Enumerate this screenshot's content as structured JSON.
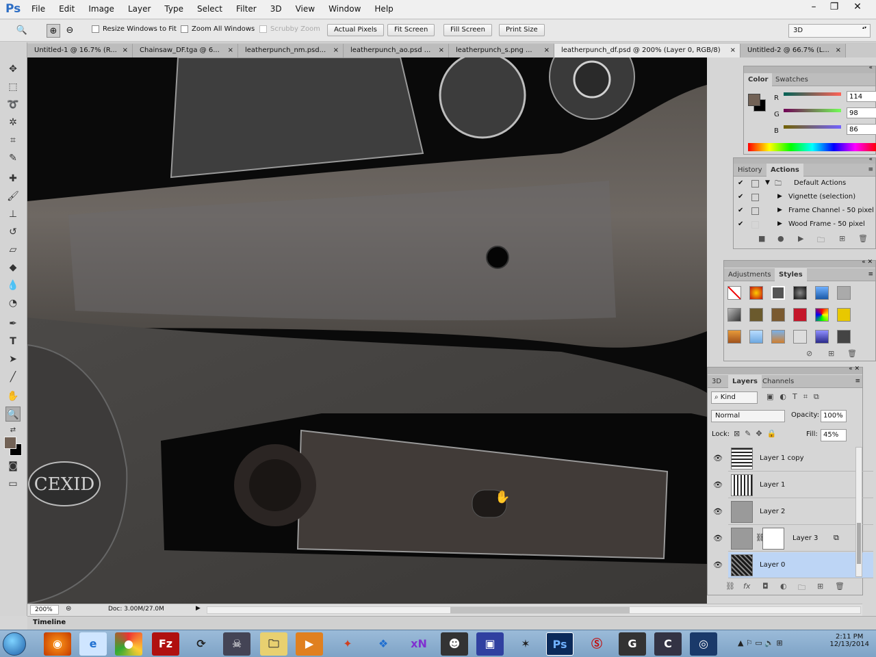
{
  "app": {
    "logo": "Ps",
    "menus": [
      "File",
      "Edit",
      "Image",
      "Layer",
      "Type",
      "Select",
      "Filter",
      "3D",
      "View",
      "Window",
      "Help"
    ]
  },
  "options": {
    "resize_windows": "Resize Windows to Fit",
    "zoom_all": "Zoom All Windows",
    "scrubby": "Scrubby Zoom",
    "actual_pixels": "Actual Pixels",
    "fit_screen": "Fit Screen",
    "fill_screen": "Fill Screen",
    "print_size": "Print Size",
    "workspace": "3D"
  },
  "tabs": [
    {
      "label": "Untitled-1 @ 16.7% (R..."
    },
    {
      "label": "Chainsaw_DF.tga @ 6..."
    },
    {
      "label": "leatherpunch_nm.psd..."
    },
    {
      "label": "leatherpunch_ao.psd ..."
    },
    {
      "label": "leatherpunch_s.png ..."
    },
    {
      "label": "leatherpunch_df.psd @ 200% (Layer 0, RGB/8)"
    },
    {
      "label": "Untitled-2 @ 66.7% (L..."
    }
  ],
  "color_panel": {
    "tabs": [
      "Color",
      "Swatches"
    ],
    "r_label": "R",
    "g_label": "G",
    "b_label": "B",
    "r": "114",
    "g": "98",
    "b": "86",
    "fg": "#726256",
    "bg": "#000000"
  },
  "history_panel": {
    "tabs": [
      "History",
      "Actions"
    ],
    "items": [
      {
        "label": "Default Actions"
      },
      {
        "label": "Vignette (selection)"
      },
      {
        "label": "Frame Channel - 50 pixel"
      },
      {
        "label": "Wood Frame - 50 pixel"
      }
    ]
  },
  "styles_panel": {
    "tabs": [
      "Adjustments",
      "Styles"
    ]
  },
  "layers_panel": {
    "tabs": [
      "3D",
      "Layers",
      "Channels"
    ],
    "kind": "Kind",
    "blend_mode": "Normal",
    "opacity_label": "Opacity:",
    "opacity": "100%",
    "lock_label": "Lock:",
    "fill_label": "Fill:",
    "fill": "45%",
    "layers": [
      {
        "name": "Layer 1 copy"
      },
      {
        "name": "Layer 1"
      },
      {
        "name": "Layer 2"
      },
      {
        "name": "Layer 3"
      },
      {
        "name": "Layer 0"
      }
    ]
  },
  "status": {
    "zoom": "200%",
    "doc": "Doc: 3.00M/27.0M"
  },
  "timeline": "Timeline",
  "taskbar": {
    "time": "2:11 PM",
    "date": "12/13/2014"
  }
}
